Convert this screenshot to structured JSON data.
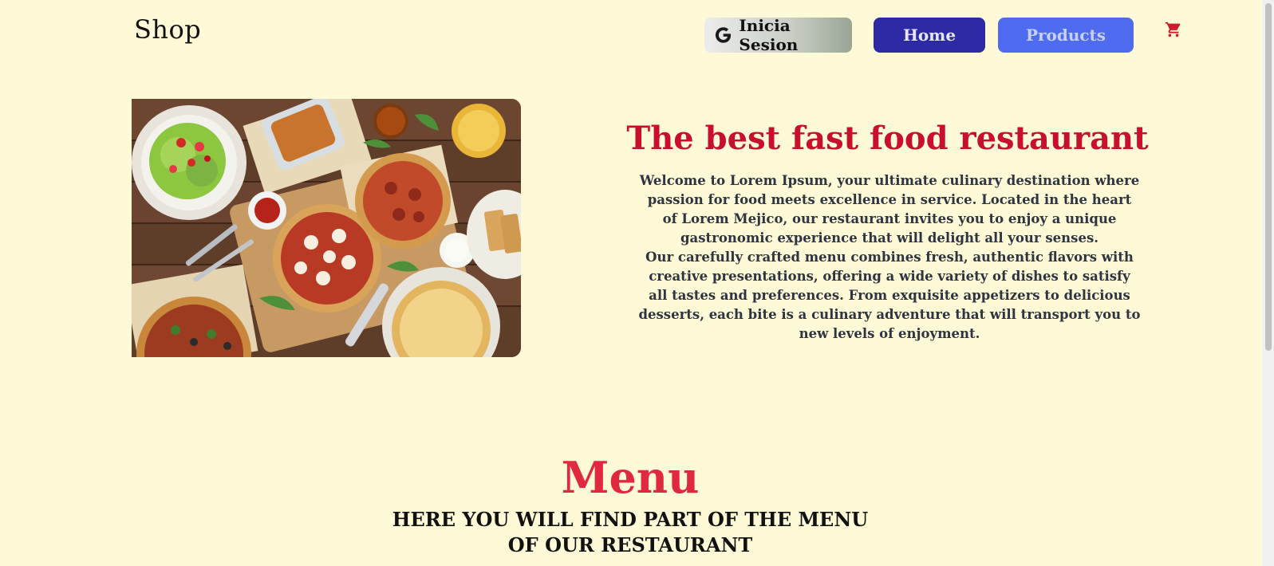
{
  "header": {
    "brand": "Shop",
    "login_label": "Inicia Sesion",
    "home_label": "Home",
    "products_label": "Products",
    "cart_icon": "cart-icon",
    "google_icon": "google-icon"
  },
  "hero": {
    "image_alt": "Table with pizzas, salad, pasta and drinks",
    "title": "The best fast food restaurant",
    "paragraph_1": "Welcome to Lorem Ipsum, your ultimate culinary destination where passion for food meets excellence in service. Located in the heart of Lorem Mejico, our restaurant invites you to enjoy a unique gastronomic experience that will delight all your senses.",
    "paragraph_2": "Our carefully crafted menu combines fresh, authentic flavors with creative presentations, offering a wide variety of dishes to satisfy all tastes and preferences. From exquisite appetizers to delicious desserts, each bite is a culinary adventure that will transport you to new levels of enjoyment."
  },
  "menu": {
    "title": "Menu",
    "subtitle": "HERE YOU WILL FIND PART OF THE MENU OF OUR RESTAURANT"
  },
  "colors": {
    "background": "#fef9d6",
    "accent_red": "#c8102e",
    "home_blue": "#2e2aa6",
    "products_blue": "#4f6bf0"
  }
}
